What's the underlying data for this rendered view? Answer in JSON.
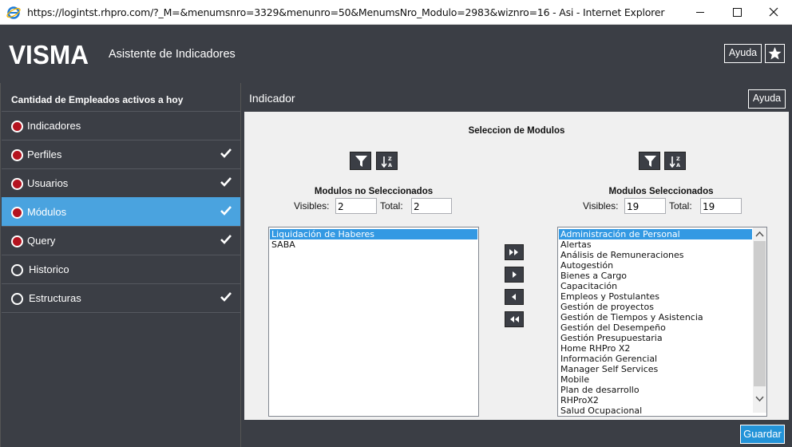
{
  "window": {
    "title": "https://logintst.rhpro.com/?_M=&menumsnro=3329&menunro=50&MenumsNro_Modulo=2983&wiznro=16 - Asi - Internet Explorer"
  },
  "header": {
    "logo_text": "VISMA",
    "app_title": "Asistente de Indicadores",
    "help_label": "Ayuda"
  },
  "sidebar": {
    "heading": "Cantidad de Empleados activos a hoy",
    "steps": [
      {
        "label": "Indicadores",
        "status": "red",
        "checked": false,
        "active": false
      },
      {
        "label": "Perfiles",
        "status": "red",
        "checked": true,
        "active": false
      },
      {
        "label": "Usuarios",
        "status": "red",
        "checked": true,
        "active": false
      },
      {
        "label": "Módulos",
        "status": "red",
        "checked": true,
        "active": true
      },
      {
        "label": "Query",
        "status": "red",
        "checked": true,
        "active": false
      },
      {
        "label": "Historico",
        "status": "empty",
        "checked": false,
        "active": false
      },
      {
        "label": "Estructuras",
        "status": "empty",
        "checked": true,
        "active": false
      }
    ]
  },
  "main": {
    "title": "Indicador",
    "help_label": "Ayuda",
    "section_title": "Seleccion de Modulos",
    "left": {
      "heading": "Modulos no Seleccionados",
      "visibles_label": "Visibles:",
      "visibles_value": "2",
      "total_label": "Total:",
      "total_value": "2",
      "items": [
        "Liquidación de Haberes",
        "SABA"
      ],
      "selected_index": 0
    },
    "right": {
      "heading": "Modulos Seleccionados",
      "visibles_label": "Visibles:",
      "visibles_value": "19",
      "total_label": "Total:",
      "total_value": "19",
      "items": [
        "Administración de Personal",
        "Alertas",
        "Análisis de Remuneraciones",
        "Autogestión",
        "Bienes a Cargo",
        "Capacitación",
        "Empleos y Postulantes",
        "Gestión de proyectos",
        "Gestión de Tiempos y Asistencia",
        "Gestión del Desempeño",
        "Gestión Presupuestaria",
        "Home RHPro X2",
        "Información Gerencial",
        "Manager Self Services",
        "Mobile",
        "Plan de desarrollo",
        "RHProX2",
        "Salud Ocupacional"
      ],
      "selected_index": 0
    },
    "save_label": "Guardar"
  },
  "colors": {
    "header_bg": "#3b3e45",
    "active_step": "#4aa3df",
    "status_red": "#b4131f",
    "selection": "#3399e3",
    "save_button": "#2393d8"
  }
}
